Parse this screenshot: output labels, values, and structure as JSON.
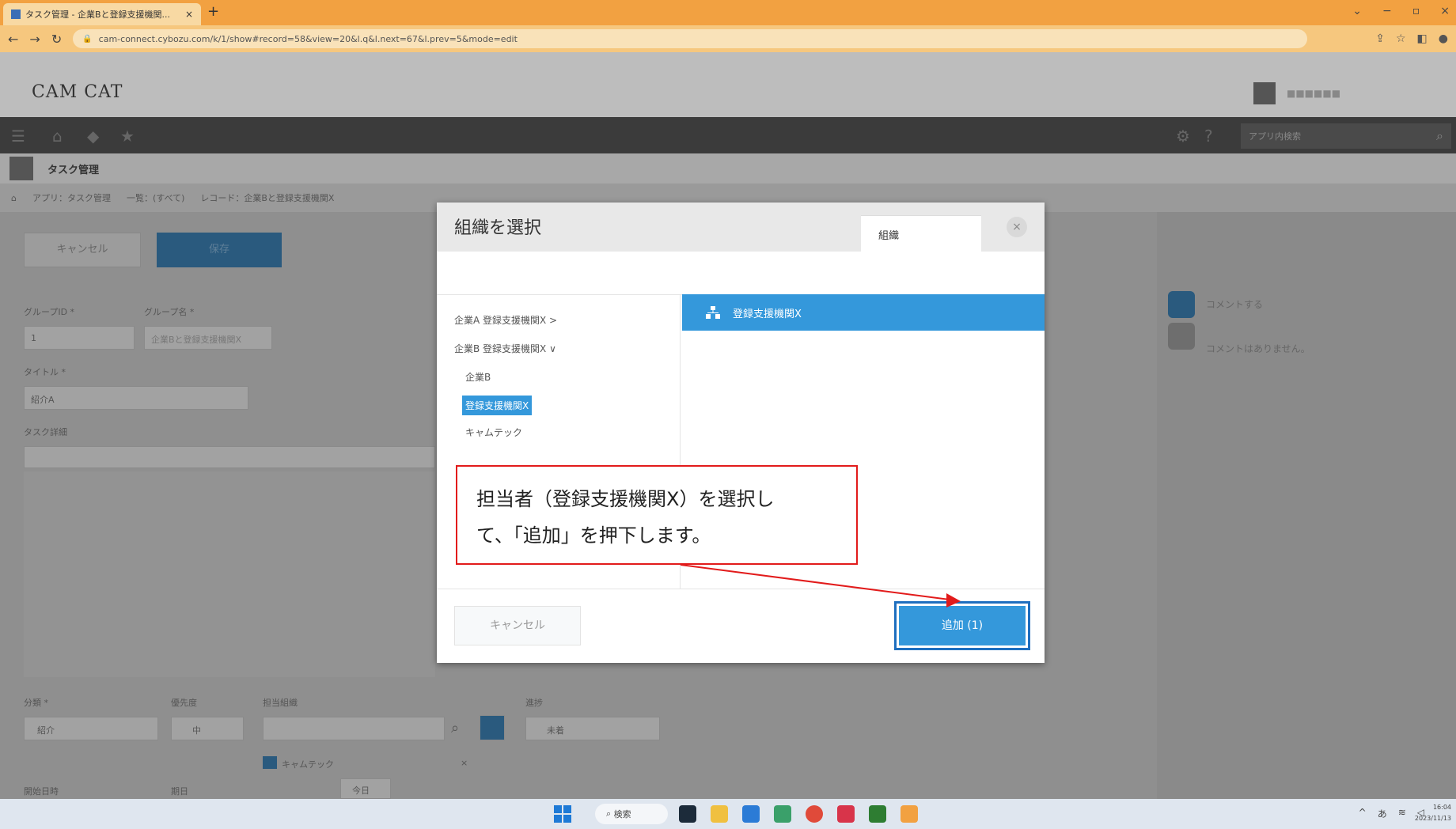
{
  "browser": {
    "tab_title": "タスク管理 - 企業Bと登録支援機関...",
    "tab_close": "×",
    "new_tab": "+",
    "url": "cam-connect.cybozu.com/k/1/show#record=58&view=20&l.q&l.next=67&l.prev=5&mode=edit",
    "win_min": "−",
    "win_restore": "▫",
    "win_close": "×"
  },
  "app": {
    "logo": "CAM CAT",
    "app_search_placeholder": "アプリ内検索",
    "app_title": "タスク管理",
    "breadcrumb": [
      "アプリ：タスク管理",
      "一覧：(すべて)",
      "レコード：企業Bと登録支援機関X"
    ],
    "cancel_label": "キャンセル",
    "save_label": "保存",
    "fields": {
      "group_id_label": "グループID *",
      "group_name_label": "グループ名 *",
      "group_id_value": "1",
      "group_name_value": "企業Bと登録支援機関X",
      "title_label": "タイトル *",
      "title_value": "紹介A",
      "task_detail_label": "タスク詳細",
      "category_label": "分類 *",
      "category_value": "紹介",
      "priority_label": "優先度",
      "priority_value": "中",
      "assignee_label": "担当組織",
      "assignee_value": "キャムテック",
      "status_label": "進捗",
      "status_value": "未着",
      "start_label": "開始日時",
      "due_label": "期日",
      "today_label": "今日"
    },
    "sidebar": {
      "comment_post": "コメントする",
      "no_comments": "コメントはありません。"
    }
  },
  "dialog": {
    "title": "組織を選択",
    "tab_label": "組織",
    "close": "×",
    "tree": [
      {
        "label": "企業A 登録支援機関X  >"
      },
      {
        "label": "企業B 登録支援機関X  ∨"
      },
      {
        "label": "企業B"
      },
      {
        "label": "登録支援機関X"
      },
      {
        "label": "キャムテック"
      }
    ],
    "selected_member": "登録支援機関X",
    "cancel_label": "キャンセル",
    "add_label": "追加 (1)"
  },
  "callout": {
    "line1": "担当者（登録支援機関X）を選択し",
    "line2": "て、「追加」を押下します。"
  },
  "taskbar": {
    "search": "検索",
    "tray_ime": "あ",
    "clock_time": "16:04",
    "clock_date": "2023/11/13"
  },
  "colors": {
    "accent": "#3498db",
    "callout_border": "#e21b1b",
    "browser_tab": "#f2a141"
  }
}
